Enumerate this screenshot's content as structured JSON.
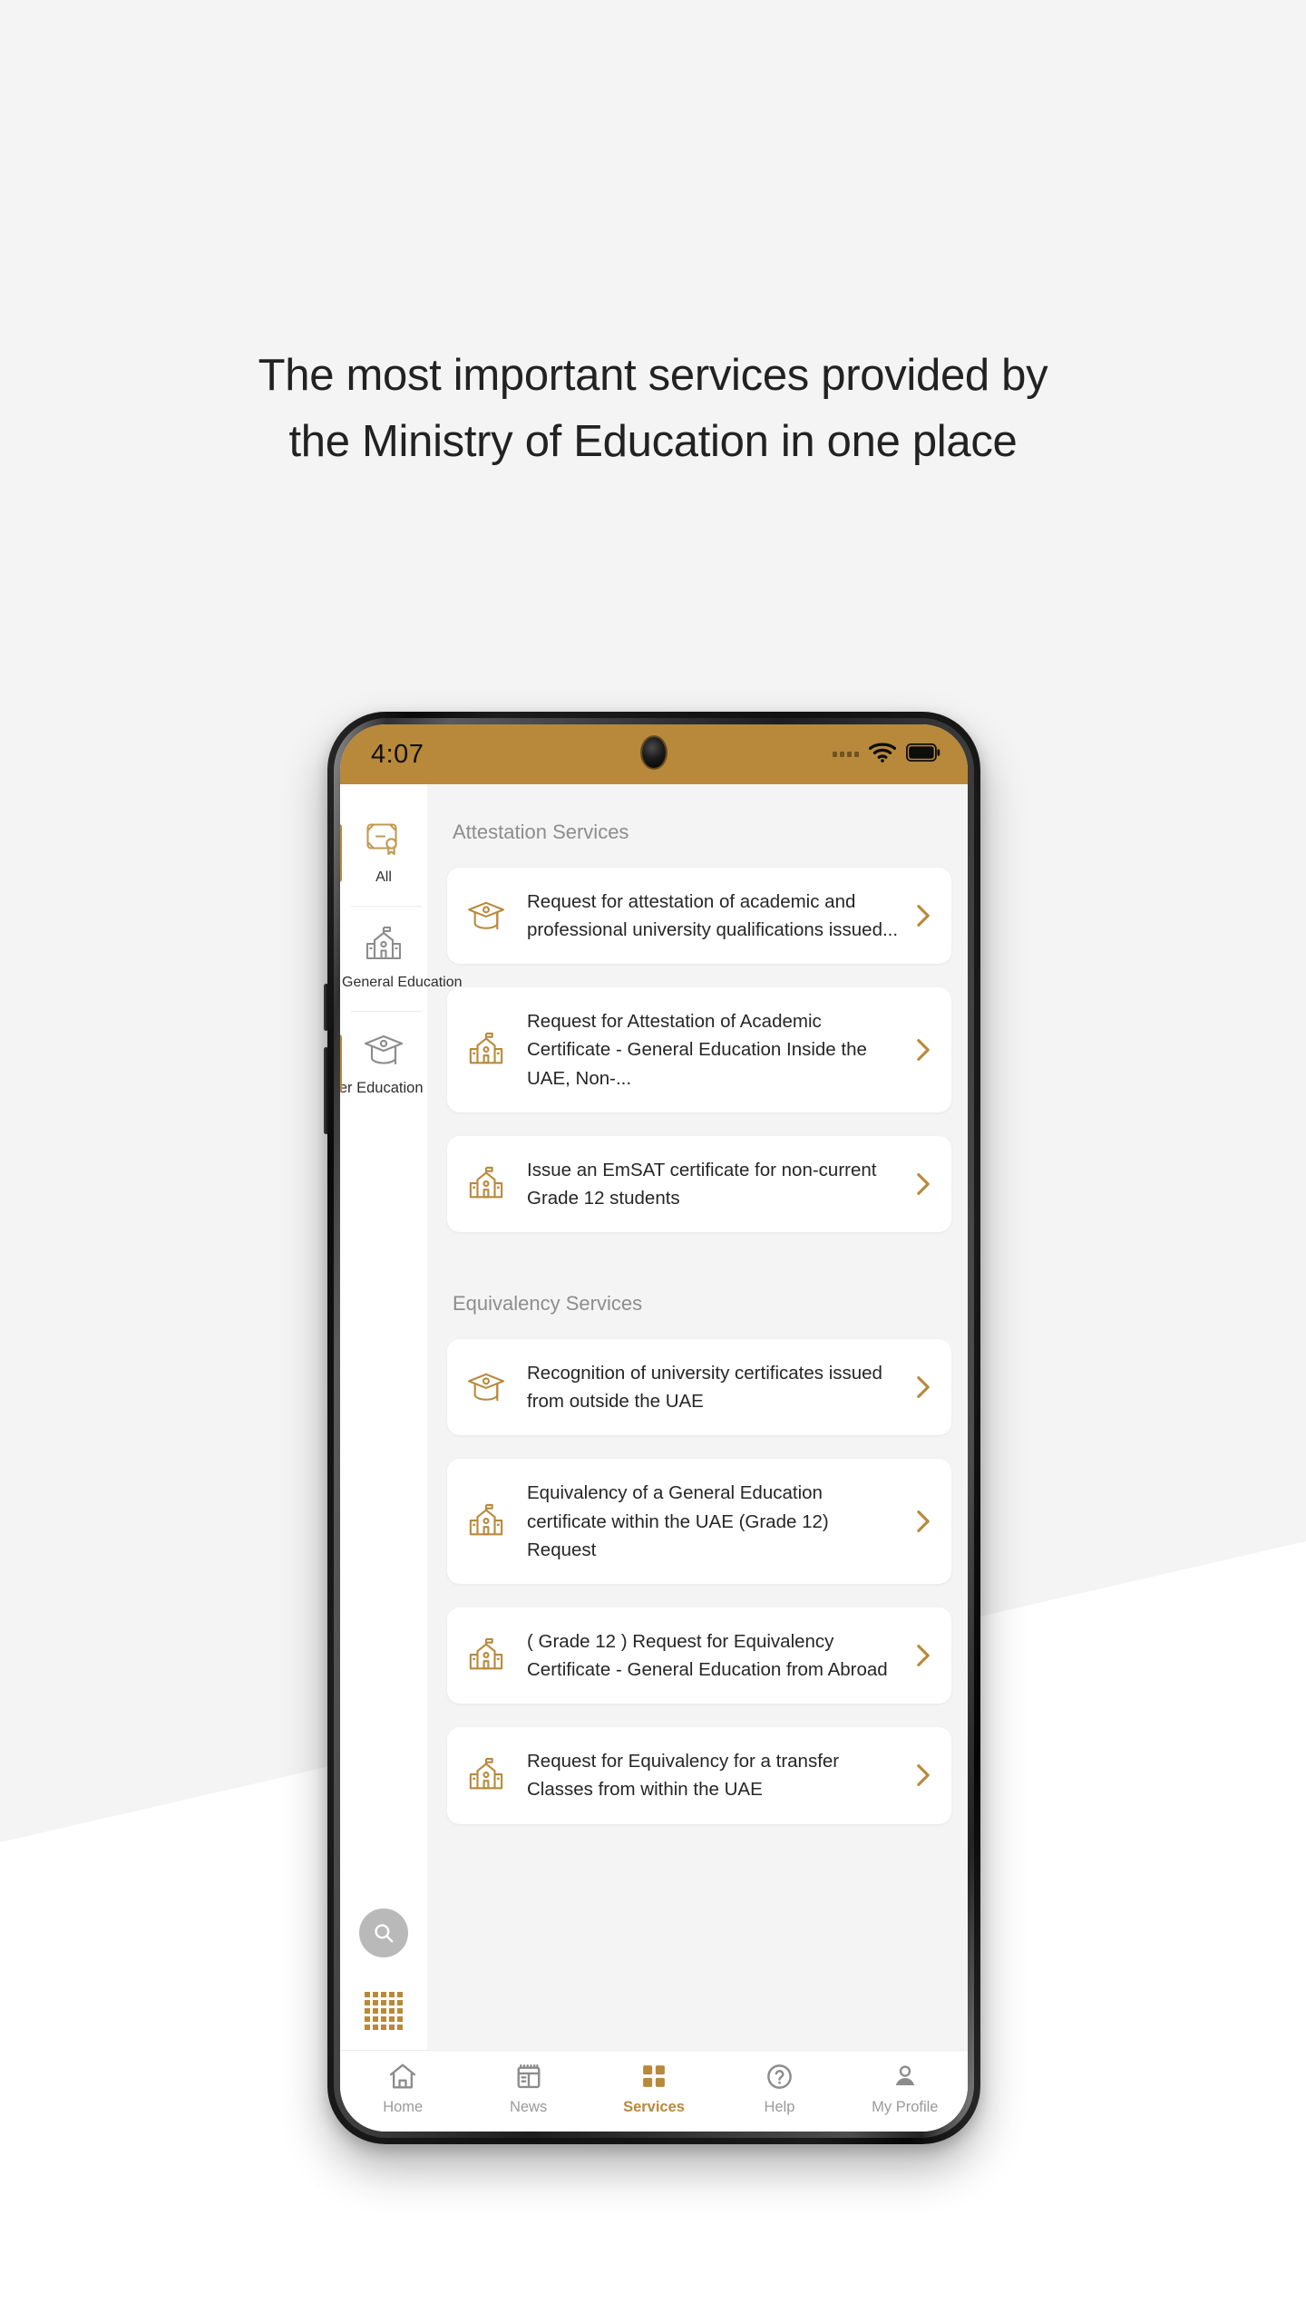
{
  "headline": {
    "line1": "The most important services provided by",
    "line2": "the Ministry of Education in one place"
  },
  "colors": {
    "gold": "#b8893a",
    "page_background": "#f4f4f4",
    "card_background": "#ffffff",
    "muted_text": "#8d8d8d"
  },
  "phone": {
    "statusbar": {
      "time": "4:07",
      "wifi_icon": "wifi-icon",
      "battery_icon": "battery-full-icon",
      "signal_icon": "signal-dots-icon",
      "camera_icon": "punch-hole-camera-icon",
      "background": "#b8893a"
    },
    "rail": {
      "items": [
        {
          "label": "All",
          "icon": "certificate-icon",
          "active": true
        },
        {
          "label": "General Education",
          "icon": "school-building-icon",
          "active": false
        },
        {
          "label": "gher Education",
          "icon": "graduation-cap-icon",
          "active": true
        }
      ],
      "search_icon": "search-icon",
      "grid_icon": "dot-grid-icon"
    },
    "sections": [
      {
        "title": "Attestation Services",
        "cards": [
          {
            "text": "Request for attestation of academic and professional university qualifications issued...",
            "icon": "graduation-cap-icon",
            "chevron": "chevron-right-icon"
          },
          {
            "text": "Request for Attestation of Academic Certificate - General Education Inside the UAE, Non-...",
            "icon": "school-building-icon",
            "chevron": "chevron-right-icon"
          },
          {
            "text": "Issue an EmSAT certificate for non-current Grade 12 students",
            "icon": "school-building-icon",
            "chevron": "chevron-right-icon"
          }
        ]
      },
      {
        "title": "Equivalency Services",
        "cards": [
          {
            "text": "Recognition of university certificates issued from outside the UAE",
            "icon": "graduation-cap-icon",
            "chevron": "chevron-right-icon"
          },
          {
            "text": "Equivalency of a General Education certificate within the UAE (Grade 12) Request",
            "icon": "school-building-icon",
            "chevron": "chevron-right-icon"
          },
          {
            "text": "( Grade 12 ) Request for Equivalency Certificate - General Education from Abroad",
            "icon": "school-building-icon",
            "chevron": "chevron-right-icon"
          },
          {
            "text": "Request for Equivalency for a transfer Classes from within the UAE",
            "icon": "school-building-icon",
            "chevron": "chevron-right-icon"
          }
        ]
      }
    ],
    "bottomnav": {
      "items": [
        {
          "label": "Home",
          "icon": "home-icon",
          "active": false
        },
        {
          "label": "News",
          "icon": "newspaper-icon",
          "active": false
        },
        {
          "label": "Services",
          "icon": "grid-squares-icon",
          "active": true
        },
        {
          "label": "Help",
          "icon": "question-circle-icon",
          "active": false
        },
        {
          "label": "My Profile",
          "icon": "person-icon",
          "active": false
        }
      ]
    }
  }
}
